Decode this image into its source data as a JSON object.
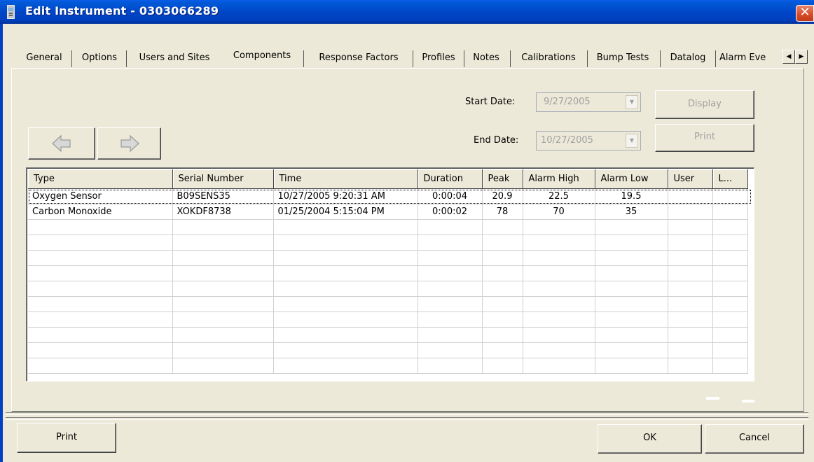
{
  "window": {
    "title": "Edit Instrument - 0303066289",
    "close_label": "✕"
  },
  "tabs": [
    {
      "label": "General"
    },
    {
      "label": "Options"
    },
    {
      "label": "Users and Sites"
    },
    {
      "label": "Components",
      "active": true
    },
    {
      "label": "Response Factors"
    },
    {
      "label": "Profiles"
    },
    {
      "label": "Notes"
    },
    {
      "label": "Calibrations"
    },
    {
      "label": "Bump Tests"
    },
    {
      "label": "Datalog"
    },
    {
      "label": "Alarm Eve"
    }
  ],
  "tab_scroll": {
    "left": "◀",
    "right": "▶"
  },
  "filters": {
    "start_label": "Start Date:",
    "start_value": "9/27/2005",
    "end_label": "End Date:",
    "end_value": "10/27/2005",
    "display_label": "Display",
    "print_label": "Print"
  },
  "grid": {
    "columns": [
      "Type",
      "Serial Number",
      "Time",
      "Duration",
      "Peak",
      "Alarm High",
      "Alarm Low",
      "User",
      "L..."
    ],
    "rows": [
      [
        "Oxygen Sensor",
        "B09SENS35",
        "10/27/2005 9:20:31 AM",
        "0:00:04",
        "20.9",
        "22.5",
        "19.5",
        "",
        ""
      ],
      [
        "Carbon Monoxide",
        "XOKDF8738",
        "01/25/2004 5:15:04 PM",
        "0:00:02",
        "78",
        "70",
        "35",
        "",
        ""
      ]
    ]
  },
  "footer": {
    "print_label": "Print",
    "ok_label": "OK",
    "cancel_label": "Cancel"
  },
  "colors": {
    "title_bar": "#0046c8",
    "dialog_bg": "#ece9d8",
    "disabled_text": "#a0a0a0",
    "close_button": "#d64a26"
  }
}
